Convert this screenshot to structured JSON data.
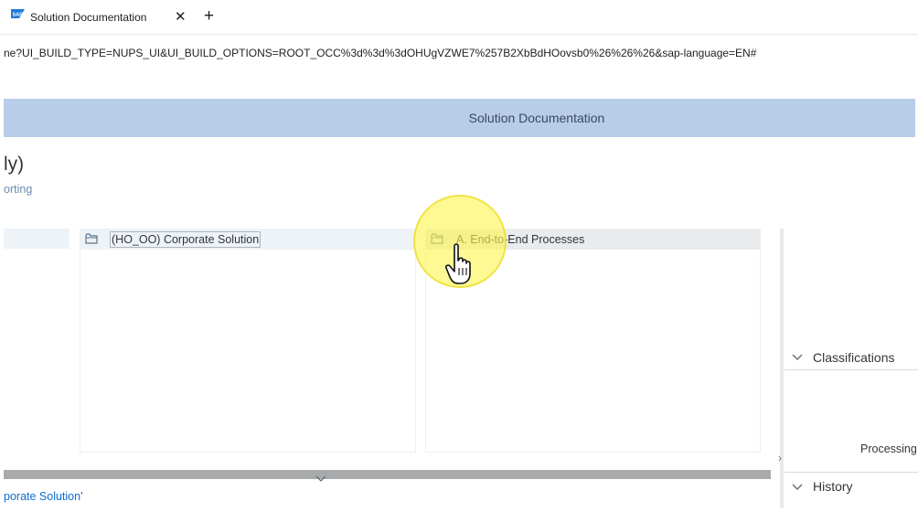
{
  "browser": {
    "tab": {
      "title": "Solution Documentation",
      "close_glyph": "✕",
      "icon": "sap-logo-icon"
    },
    "new_tab_glyph": "+",
    "url": "ne?UI_BUILD_TYPE=NUPS_UI&UI_BUILD_OPTIONS=ROOT_OCC%3d%3d%3dOHUgVZWE7%257B2XbBdHOovsb0%26%26%26&sap-language=EN#"
  },
  "shell": {
    "title": "Solution Documentation"
  },
  "page": {
    "title": "ly)",
    "subtitle": "orting"
  },
  "columns": {
    "col1": {
      "item_label": "(HO_OO) Corporate Solution",
      "icon": "folder-icon"
    },
    "col2": {
      "item_label": "A. End-to-End Processes",
      "icon": "folder-icon"
    }
  },
  "bottom": {
    "link_text": "porate Solution'"
  },
  "side_panel": {
    "classifications_label": "Classifications",
    "processing_label": "Processing",
    "history_label": "History"
  },
  "colors": {
    "shell_bar": "#b8cde8",
    "selected_row": "#eef3f8",
    "hover_row": "#eaebec",
    "link": "#0a6ed1",
    "cursor_highlight": "#fff550"
  }
}
